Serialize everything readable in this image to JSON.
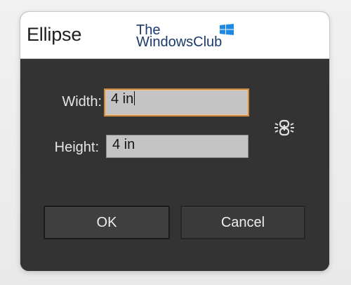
{
  "dialog": {
    "title": "Ellipse"
  },
  "watermark": {
    "line1": "The",
    "line2": "WindowsClub"
  },
  "fields": {
    "width": {
      "label": "Width:",
      "value": "4 in"
    },
    "height": {
      "label": "Height:",
      "value": "4 in"
    }
  },
  "constrain_icon": "link-constrain-proportions-icon",
  "buttons": {
    "ok_label": "OK",
    "cancel_label": "Cancel"
  },
  "colors": {
    "dialog_bg": "#333333",
    "field_bg": "#c4c4c4",
    "focus_border": "#c98b45",
    "watermark_logo": "#1e88e5"
  }
}
